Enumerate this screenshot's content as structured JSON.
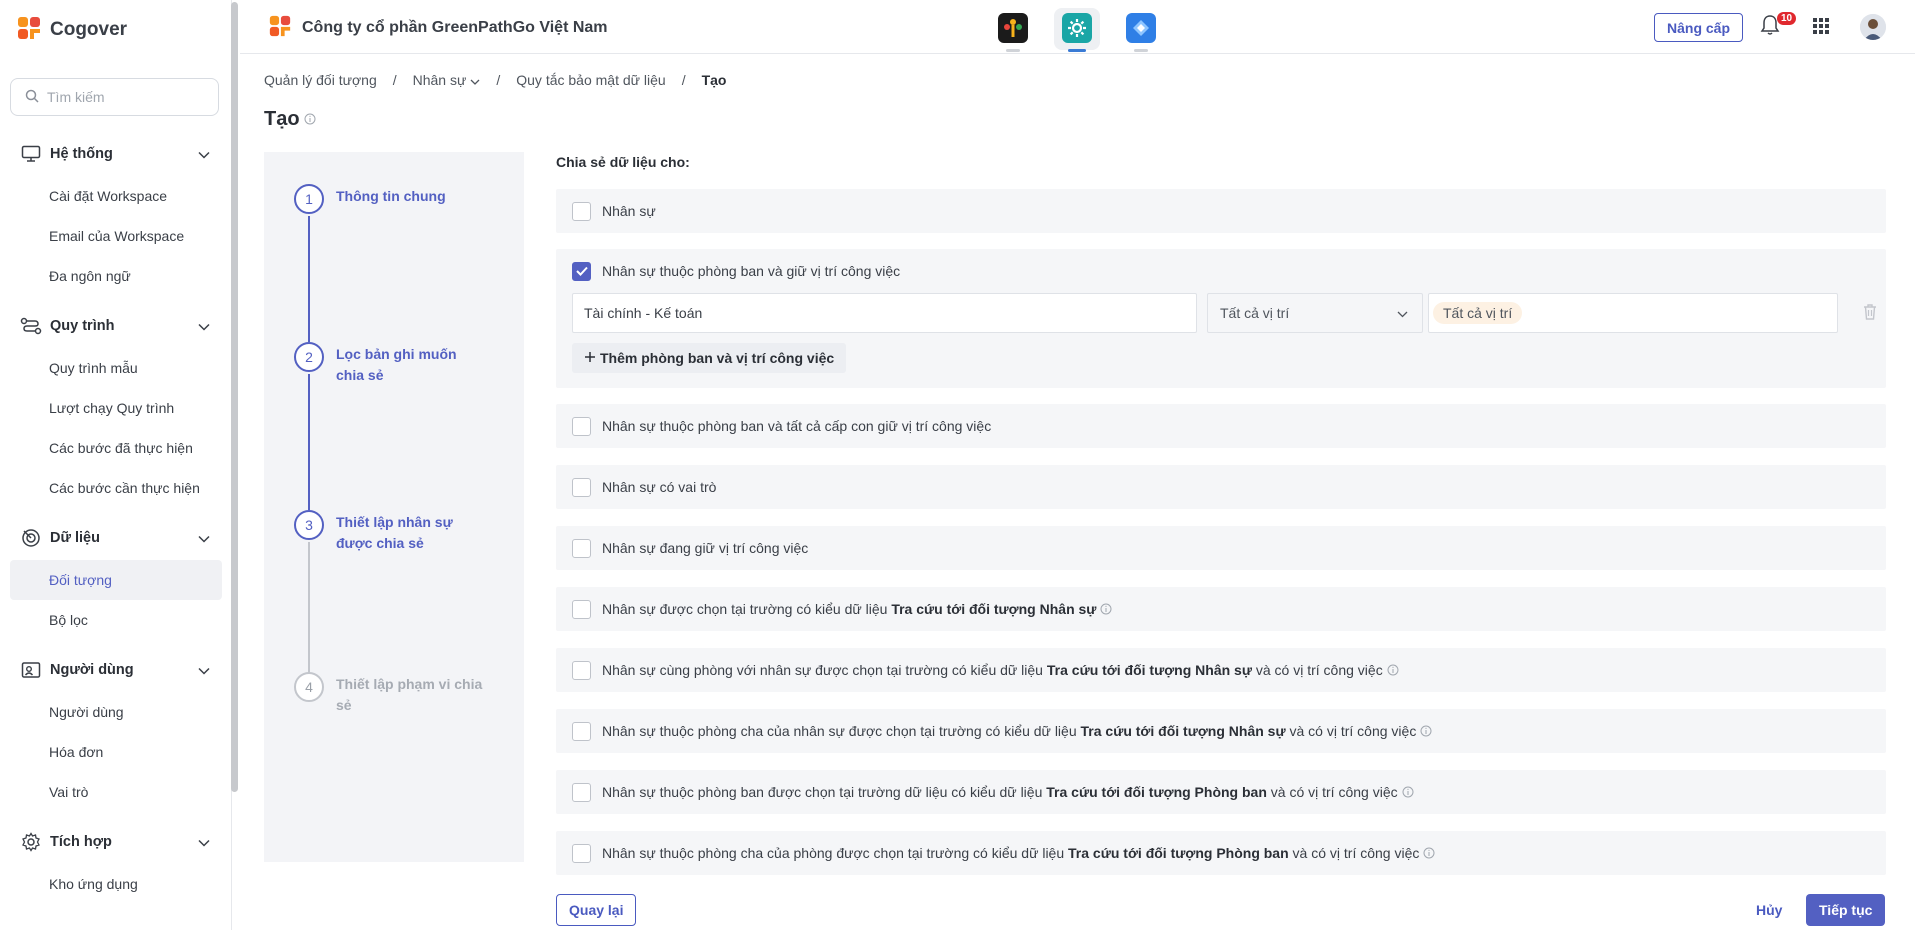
{
  "brand": {
    "name": "Cogover"
  },
  "search": {
    "placeholder": "Tìm kiếm"
  },
  "sidebar": {
    "groups": [
      {
        "label": "Hệ thống",
        "icon": "monitor-icon",
        "items": [
          "Cài đặt Workspace",
          "Email của Workspace",
          "Đa ngôn ngữ"
        ]
      },
      {
        "label": "Quy trình",
        "icon": "workflow-icon",
        "items": [
          "Quy trình mẫu",
          "Lượt chạy Quy trình",
          "Các bước đã thực hiện",
          "Các bước cần thực hiện"
        ]
      },
      {
        "label": "Dữ liệu",
        "icon": "data-icon",
        "items": [
          "Đối tượng",
          "Bộ lọc"
        ]
      },
      {
        "label": "Người dùng",
        "icon": "user-card-icon",
        "items": [
          "Người dùng",
          "Hóa đơn",
          "Vai trò"
        ]
      },
      {
        "label": "Tích hợp",
        "icon": "gear-icon",
        "items": [
          "Kho ứng dụng"
        ]
      }
    ],
    "active_item": "Đối tượng"
  },
  "header": {
    "company": "Công ty cổ phần GreenPathGo Việt Nam",
    "upgrade_label": "Nâng cấp",
    "notification_count": "10"
  },
  "breadcrumb": {
    "items": [
      "Quản lý đối tượng",
      "Nhân sự",
      "Quy tắc bảo mật dữ liệu"
    ],
    "current": "Tạo"
  },
  "page_title": "Tạo",
  "stepper": {
    "steps": [
      {
        "num": "1",
        "label": "Thông tin chung"
      },
      {
        "num": "2",
        "label": "Lọc bản ghi muốn chia sẻ"
      },
      {
        "num": "3",
        "label": "Thiết lập nhân sự được chia sẻ"
      },
      {
        "num": "4",
        "label": "Thiết lập phạm vi chia sẻ"
      }
    ]
  },
  "share": {
    "title": "Chia sẻ dữ liệu cho:",
    "options": {
      "o1": {
        "text": "Nhân sự",
        "checked": false
      },
      "o2": {
        "text": "Nhân sự thuộc phòng ban và giữ vị trí công việc",
        "checked": true
      },
      "o3": {
        "text": "Nhân sự thuộc phòng ban và tất cả cấp con giữ vị trí công việc",
        "checked": false
      },
      "o4": {
        "text": "Nhân sự có vai trò",
        "checked": false
      },
      "o5": {
        "text": "Nhân sự đang giữ vị trí công việc",
        "checked": false
      },
      "o6": {
        "pre": "Nhân sự được chọn tại trường có kiểu dữ liệu ",
        "bold": "Tra cứu tới đối tượng Nhân sự",
        "post": ""
      },
      "o7": {
        "pre": "Nhân sự cùng phòng với nhân sự được chọn tại trường có kiểu dữ liệu ",
        "bold": "Tra cứu tới đối tượng Nhân sự",
        "post": " và có vị trí công việc"
      },
      "o8": {
        "pre": "Nhân sự thuộc phòng cha của nhân sự được chọn tại trường có kiểu dữ liệu ",
        "bold": "Tra cứu tới đối tượng Nhân sự",
        "post": " và có vị trí công việc"
      },
      "o9": {
        "pre": "Nhân sự thuộc phòng ban được chọn tại trường dữ liệu có kiểu dữ liệu ",
        "bold": "Tra cứu tới đối tượng Phòng ban",
        "post": " và có vị trí công việc"
      },
      "o10": {
        "pre": "Nhân sự thuộc phòng cha của phòng được chọn tại trường có kiểu dữ liệu ",
        "bold": "Tra cứu tới đối tượng Phòng ban",
        "post": " và có vị trí công việc"
      }
    },
    "dept_value": "Tài chính - Kế toán",
    "position_value": "Tất cả vị trí",
    "position_tag": "Tất cả vị trí",
    "add_label": "Thêm phòng ban và vị trí công việc"
  },
  "footer": {
    "back_label": "Quay lại",
    "cancel_label": "Hủy",
    "next_label": "Tiếp tục"
  },
  "colors": {
    "accent": "#5360c2",
    "panel": "#f5f6f8"
  }
}
